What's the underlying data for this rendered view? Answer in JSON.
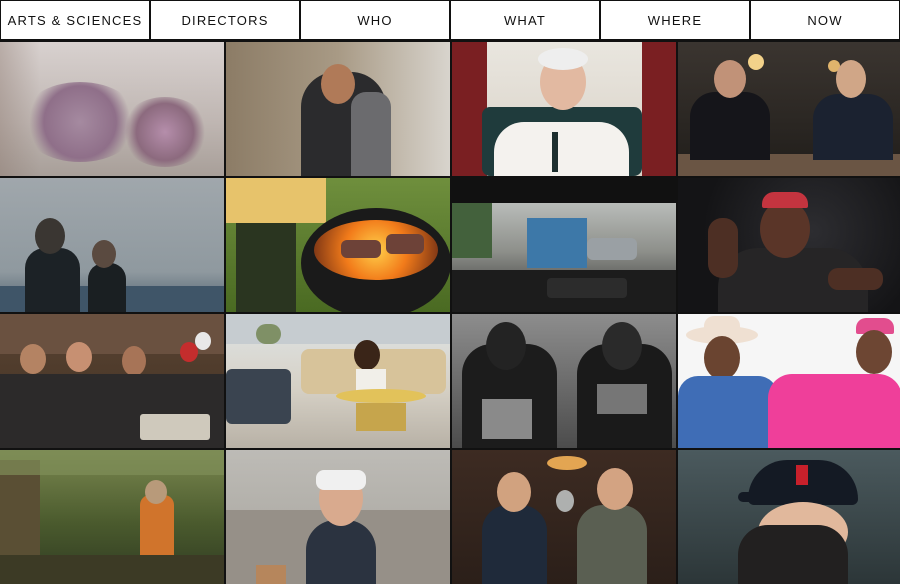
{
  "nav": {
    "items": [
      "ARTS & SCIENCES",
      "DIRECTORS",
      "WHO",
      "WHAT",
      "WHERE",
      "NOW"
    ]
  },
  "tiles": [
    {
      "name": "flowers-tile",
      "bg": "#c9c2c0"
    },
    {
      "name": "embrace-tile",
      "bg": "#8f7f6a"
    },
    {
      "name": "colonel-tile",
      "bg": "#f0ede8"
    },
    {
      "name": "bar-scene-tile",
      "bg": "#2a2724"
    },
    {
      "name": "ocean-swimmers-tile",
      "bg": "#8a99a3"
    },
    {
      "name": "grill-tile",
      "bg": "#4f6e2a"
    },
    {
      "name": "car-dashboard-tile",
      "bg": "#6d6c68"
    },
    {
      "name": "gesture-man-tile",
      "bg": "#1a1a1c"
    },
    {
      "name": "party-room-tile",
      "bg": "#4d3a2a"
    },
    {
      "name": "living-room-tile",
      "bg": "#cfcbc2"
    },
    {
      "name": "metal-vests-tile",
      "bg": "#5a5a5a"
    },
    {
      "name": "cowboy-hats-tile",
      "bg": "#f2f2f2"
    },
    {
      "name": "forest-tile",
      "bg": "#4d5a31"
    },
    {
      "name": "vr-headset-tile",
      "bg": "#a9a7a1"
    },
    {
      "name": "diner-friends-tile",
      "bg": "#3a2b24"
    },
    {
      "name": "baseball-tile",
      "bg": "#2f3a3e"
    }
  ]
}
